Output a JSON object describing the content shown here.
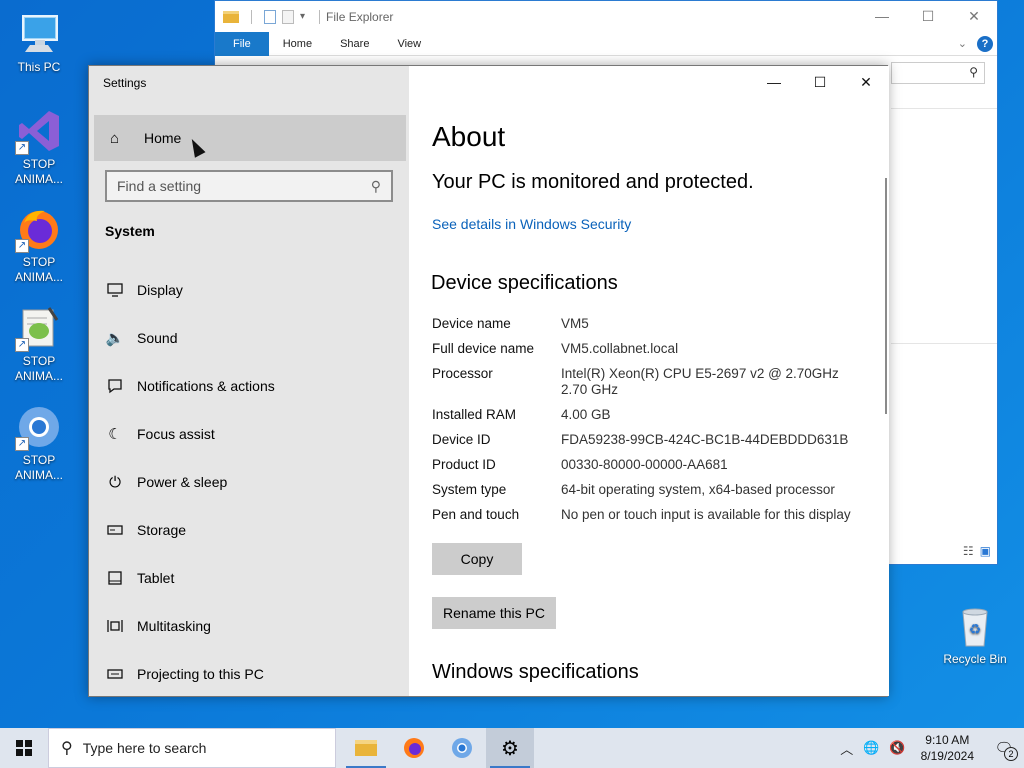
{
  "desktop": {
    "icons": [
      {
        "label": "This PC"
      },
      {
        "label": "STOP ANIMA..."
      },
      {
        "label": "STOP ANIMA..."
      },
      {
        "label": "STOP ANIMA..."
      },
      {
        "label": "STOP ANIMA..."
      }
    ],
    "recycle_bin": "Recycle Bin"
  },
  "explorer": {
    "title": "File Explorer",
    "tabs": [
      "File",
      "Home",
      "Share",
      "View"
    ]
  },
  "settings": {
    "window_title": "Settings",
    "home_label": "Home",
    "search_placeholder": "Find a setting",
    "section_heading": "System",
    "nav": [
      {
        "label": "Display",
        "icon": "display-icon"
      },
      {
        "label": "Sound",
        "icon": "sound-icon"
      },
      {
        "label": "Notifications & actions",
        "icon": "notifications-icon"
      },
      {
        "label": "Focus assist",
        "icon": "focus-assist-icon"
      },
      {
        "label": "Power & sleep",
        "icon": "power-icon"
      },
      {
        "label": "Storage",
        "icon": "storage-icon"
      },
      {
        "label": "Tablet",
        "icon": "tablet-icon"
      },
      {
        "label": "Multitasking",
        "icon": "multitasking-icon"
      },
      {
        "label": "Projecting to this PC",
        "icon": "projecting-icon"
      }
    ],
    "about": {
      "title": "About",
      "protection": "Your PC is monitored and protected.",
      "security_link": "See details in Windows Security",
      "device_heading": "Device specifications",
      "specs": [
        {
          "key": "Device name",
          "value": "VM5"
        },
        {
          "key": "Full device name",
          "value": "VM5.collabnet.local"
        },
        {
          "key": "Processor",
          "value": "Intel(R) Xeon(R) CPU E5-2697 v2 @ 2.70GHz 2.70 GHz"
        },
        {
          "key": "Installed RAM",
          "value": "4.00 GB"
        },
        {
          "key": "Device ID",
          "value": "FDA59238-99CB-424C-BC1B-44DEBDDD631B"
        },
        {
          "key": "Product ID",
          "value": "00330-80000-00000-AA681"
        },
        {
          "key": "System type",
          "value": "64-bit operating system, x64-based processor"
        },
        {
          "key": "Pen and touch",
          "value": "No pen or touch input is available for this display"
        }
      ],
      "copy_label": "Copy",
      "rename_label": "Rename this PC",
      "windows_heading": "Windows specifications"
    }
  },
  "taskbar": {
    "search_placeholder": "Type here to search",
    "time": "9:10 AM",
    "date": "8/19/2024",
    "notification_count": "2"
  }
}
